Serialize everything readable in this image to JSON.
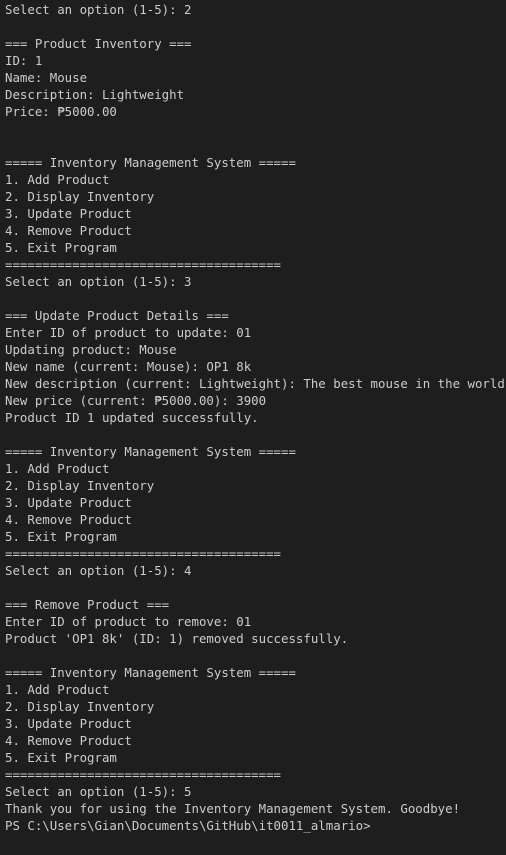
{
  "terminal": {
    "lines": [
      "Select an option (1-5): 2",
      "",
      "=== Product Inventory ===",
      "ID: 1",
      "Name: Mouse",
      "Description: Lightweight",
      "Price: ₱5000.00",
      "",
      "",
      "===== Inventory Management System =====",
      "1. Add Product",
      "2. Display Inventory",
      "3. Update Product",
      "4. Remove Product",
      "5. Exit Program",
      "=====================================",
      "Select an option (1-5): 3",
      "",
      "=== Update Product Details ===",
      "Enter ID of product to update: 01",
      "Updating product: Mouse",
      "New name (current: Mouse): OP1 8k",
      "New description (current: Lightweight): The best mouse in the world",
      "New price (current: ₱5000.00): 3900",
      "Product ID 1 updated successfully.",
      "",
      "===== Inventory Management System =====",
      "1. Add Product",
      "2. Display Inventory",
      "3. Update Product",
      "4. Remove Product",
      "5. Exit Program",
      "=====================================",
      "Select an option (1-5): 4",
      "",
      "=== Remove Product ===",
      "Enter ID of product to remove: 01",
      "Product 'OP1 8k' (ID: 1) removed successfully.",
      "",
      "===== Inventory Management System =====",
      "1. Add Product",
      "2. Display Inventory",
      "3. Update Product",
      "4. Remove Product",
      "5. Exit Program",
      "=====================================",
      "Select an option (1-5): 5",
      "Thank you for using the Inventory Management System. Goodbye!",
      "PS C:\\Users\\Gian\\Documents\\GitHub\\it0011_almario>"
    ]
  },
  "colors": {
    "background": "#1e1e1e",
    "text": "#cccccc"
  }
}
